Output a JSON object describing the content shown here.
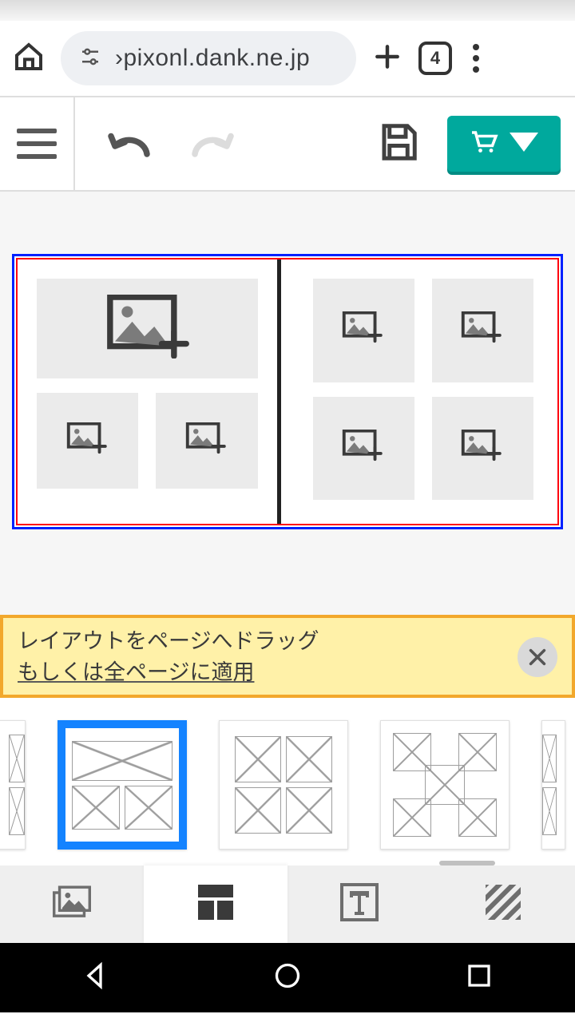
{
  "browser": {
    "url_text": "›pixonl.dank.ne.jp",
    "tab_count": "4"
  },
  "hint": {
    "line1": "レイアウトをページへドラッグ",
    "line2": "もしくは全ページに適用"
  },
  "colors": {
    "accent_teal": "#00a99d",
    "select_blue": "#1483ff",
    "banner_bg": "#fff1a8",
    "banner_border": "#f2a82c"
  },
  "layout_templates": {
    "selected_index": 0,
    "items": [
      {
        "id": "featured-2",
        "rows": [
          "wide",
          "2"
        ]
      },
      {
        "id": "grid-2x2",
        "rows": [
          "2",
          "2"
        ]
      },
      {
        "id": "corners-center",
        "rows": [
          "custom"
        ]
      }
    ]
  },
  "bottom_tabs": {
    "active_index": 1,
    "items": [
      {
        "id": "photos",
        "label": "photos"
      },
      {
        "id": "layouts",
        "label": "layouts"
      },
      {
        "id": "text",
        "label": "text"
      },
      {
        "id": "backgrounds",
        "label": "backgrounds"
      }
    ]
  }
}
